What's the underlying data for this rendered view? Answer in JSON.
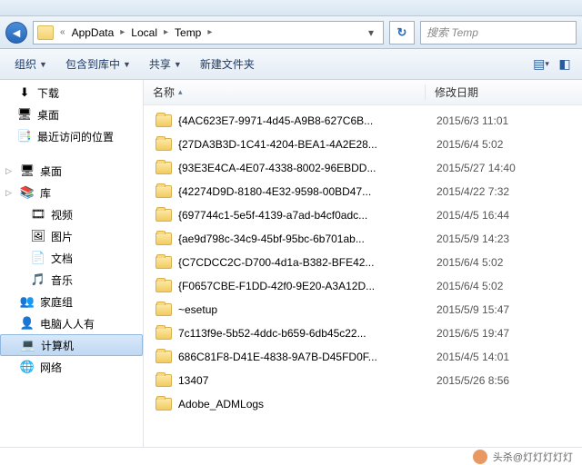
{
  "breadcrumb": {
    "prefix": "«",
    "items": [
      "AppData",
      "Local",
      "Temp"
    ],
    "sep": "▸"
  },
  "search": {
    "placeholder": "搜索 Temp"
  },
  "toolbar": {
    "organize": "组织",
    "include": "包含到库中",
    "share": "共享",
    "newfolder": "新建文件夹"
  },
  "sidebar": {
    "groupA": [
      {
        "label": "下载",
        "icon": "⬇"
      },
      {
        "label": "桌面",
        "icon": "🖥"
      },
      {
        "label": "最近访问的位置",
        "icon": "📑"
      }
    ],
    "groupB": [
      {
        "label": "桌面",
        "icon": "🖥",
        "top": true
      },
      {
        "label": "库",
        "icon": "📚",
        "expand": true
      },
      {
        "label": "视频",
        "icon": "🎞",
        "indent": true
      },
      {
        "label": "图片",
        "icon": "🖼",
        "indent": true
      },
      {
        "label": "文档",
        "icon": "📄",
        "indent": true
      },
      {
        "label": "音乐",
        "icon": "🎵",
        "indent": true
      },
      {
        "label": "家庭组",
        "icon": "👥"
      },
      {
        "label": "电脑人人有",
        "icon": "👤"
      },
      {
        "label": "计算机",
        "icon": "💻",
        "highlight": true
      },
      {
        "label": "网络",
        "icon": "🌐"
      }
    ]
  },
  "columns": {
    "name": "名称",
    "date": "修改日期"
  },
  "files": [
    {
      "name": "{4AC623E7-9971-4d45-A9B8-627C6B...",
      "date": "2015/6/3 11:01"
    },
    {
      "name": "{27DA3B3D-1C41-4204-BEA1-4A2E28...",
      "date": "2015/6/4 5:02"
    },
    {
      "name": "{93E3E4CA-4E07-4338-8002-96EBDD...",
      "date": "2015/5/27 14:40"
    },
    {
      "name": "{42274D9D-8180-4E32-9598-00BD47...",
      "date": "2015/4/22 7:32"
    },
    {
      "name": "{697744c1-5e5f-4139-a7ad-b4cf0adc...",
      "date": "2015/4/5 16:44"
    },
    {
      "name": "{ae9d798c-34c9-45bf-95bc-6b701ab...",
      "date": "2015/5/9 14:23"
    },
    {
      "name": "{C7CDCC2C-D700-4d1a-B382-BFE42...",
      "date": "2015/6/4 5:02"
    },
    {
      "name": "{F0657CBE-F1DD-42f0-9E20-A3A12D...",
      "date": "2015/6/4 5:02"
    },
    {
      "name": "~esetup",
      "date": "2015/5/9 15:47"
    },
    {
      "name": "7c113f9e-5b52-4ddc-b659-6db45c22...",
      "date": "2015/6/5 19:47"
    },
    {
      "name": "686C81F8-D41E-4838-9A7B-D45FD0F...",
      "date": "2015/4/5 14:01"
    },
    {
      "name": "13407",
      "date": "2015/5/26 8:56"
    },
    {
      "name": "Adobe_ADMLogs",
      "date": ""
    }
  ],
  "footer": {
    "text": "头杀@灯灯灯灯灯"
  }
}
